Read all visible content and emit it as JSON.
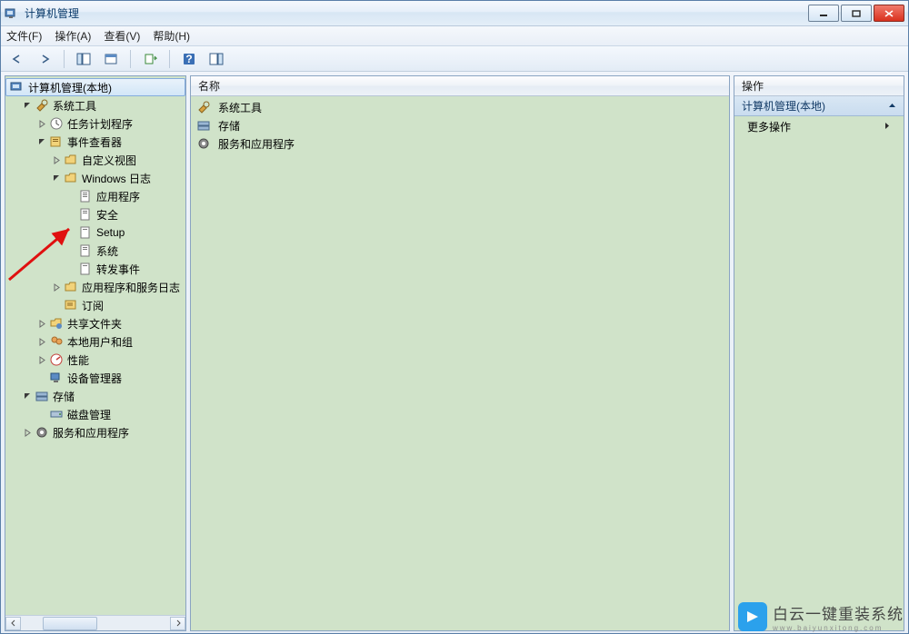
{
  "window": {
    "title": "计算机管理"
  },
  "menu": {
    "file": "文件(F)",
    "action": "操作(A)",
    "view": "查看(V)",
    "help": "帮助(H)"
  },
  "tree_root": "计算机管理(本地)",
  "tree": {
    "systools": "系统工具",
    "task_scheduler": "任务计划程序",
    "event_viewer": "事件查看器",
    "custom_views": "自定义视图",
    "windows_logs": "Windows 日志",
    "app": "应用程序",
    "security": "安全",
    "setup": "Setup",
    "system": "系统",
    "forwarded": "转发事件",
    "app_service_logs": "应用程序和服务日志",
    "subscriptions": "订阅",
    "shared_folders": "共享文件夹",
    "local_users": "本地用户和组",
    "performance": "性能",
    "device_manager": "设备管理器",
    "storage": "存储",
    "disk_mgmt": "磁盘管理",
    "services_apps": "服务和应用程序"
  },
  "mid": {
    "header": "名称",
    "items": [
      "系统工具",
      "存储",
      "服务和应用程序"
    ]
  },
  "right": {
    "header": "操作",
    "section": "计算机管理(本地)",
    "more": "更多操作"
  },
  "watermark": {
    "brand": "白云一键重装系统",
    "url": "www.baiyunxitong.com"
  }
}
